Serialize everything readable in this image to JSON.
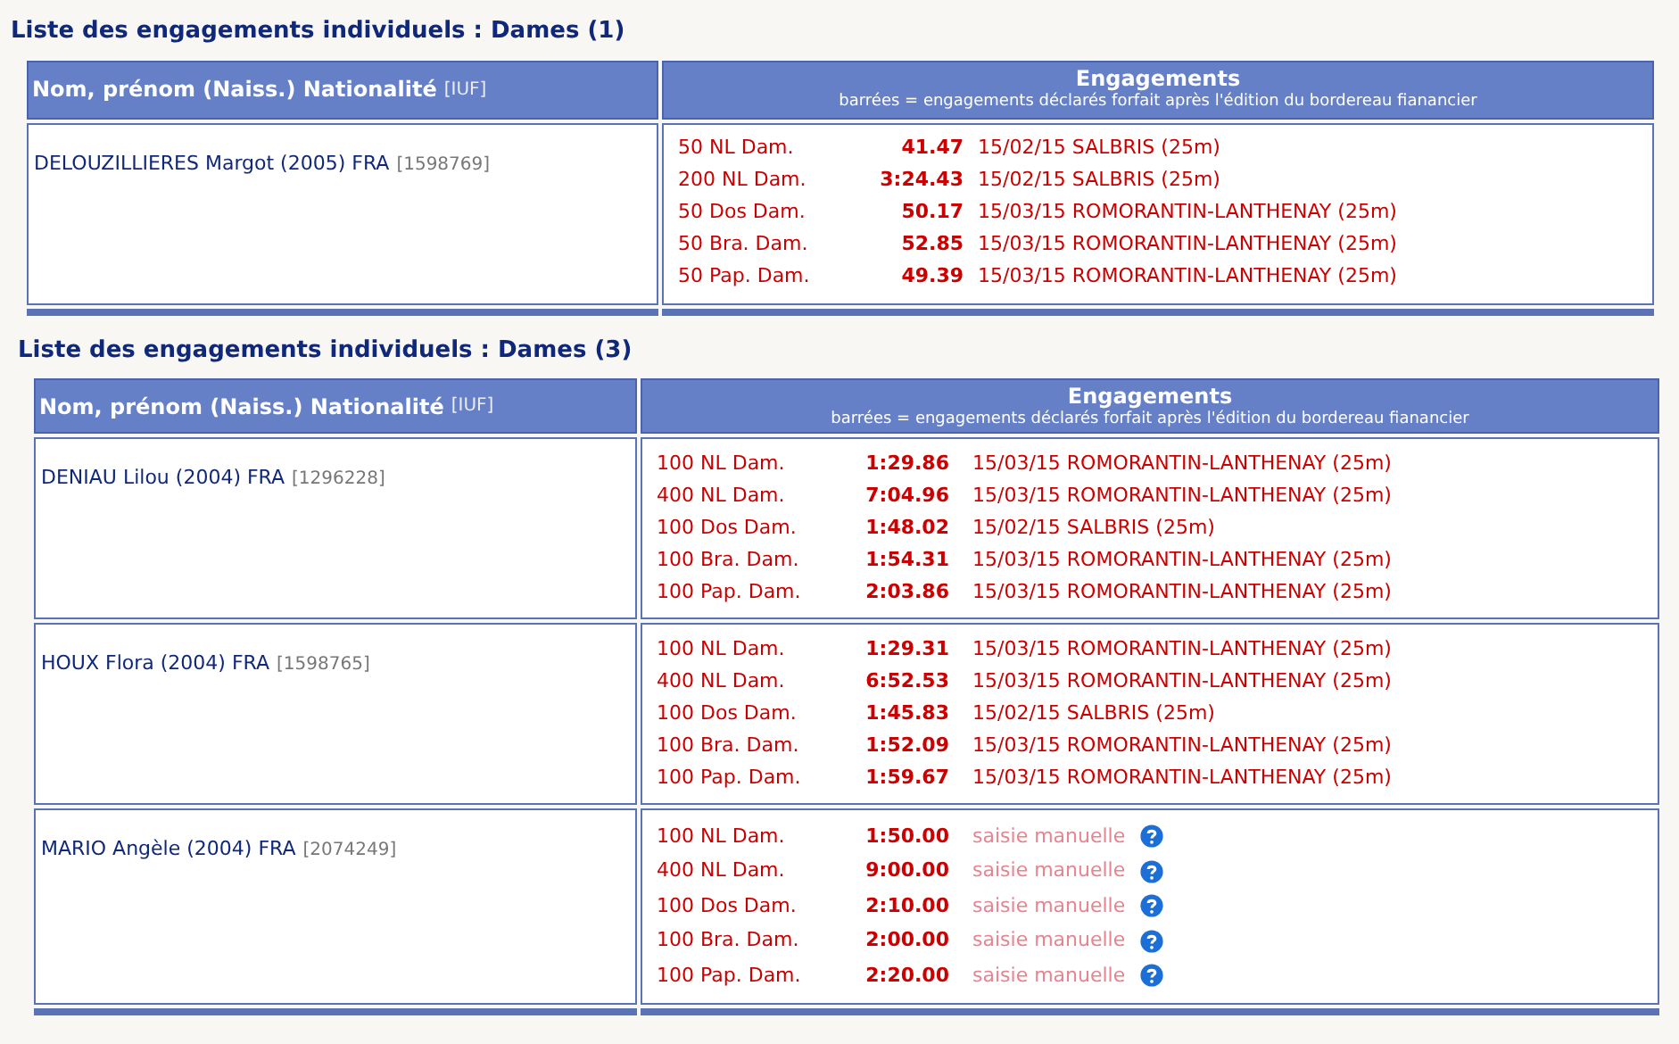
{
  "sections": [
    {
      "title": "Liste des engagements individuels : Dames (1)",
      "columns": {
        "name": "Nom, prénom (Naiss.) Nationalité",
        "iuf": "[IUF]",
        "entries": "Engagements",
        "note": "barrées = engagements déclarés forfait après l'édition du bordereau fianancier"
      },
      "rows": [
        {
          "swimmer": "DELOUZILLIERES Margot (2005) FRA",
          "iuf": "[1598769]",
          "entries": [
            {
              "kind": "meet",
              "event": "50 NL Dam.",
              "time": "41.47",
              "meet": "15/02/15 SALBRIS (25m)"
            },
            {
              "kind": "meet",
              "event": "200 NL Dam.",
              "time": "3:24.43",
              "meet": "15/02/15 SALBRIS (25m)"
            },
            {
              "kind": "meet",
              "event": "50 Dos Dam.",
              "time": "50.17",
              "meet": "15/03/15 ROMORANTIN-LANTHENAY (25m)"
            },
            {
              "kind": "meet",
              "event": "50 Bra. Dam.",
              "time": "52.85",
              "meet": "15/03/15 ROMORANTIN-LANTHENAY (25m)"
            },
            {
              "kind": "meet",
              "event": "50 Pap. Dam.",
              "time": "49.39",
              "meet": "15/03/15 ROMORANTIN-LANTHENAY (25m)"
            }
          ]
        }
      ]
    },
    {
      "title": "Liste des engagements individuels : Dames (3)",
      "columns": {
        "name": "Nom, prénom (Naiss.) Nationalité",
        "iuf": "[IUF]",
        "entries": "Engagements",
        "note": "barrées = engagements déclarés forfait après l'édition du bordereau fianancier"
      },
      "rows": [
        {
          "swimmer": "DENIAU Lilou (2004) FRA",
          "iuf": "[1296228]",
          "entries": [
            {
              "kind": "meet",
              "event": "100 NL Dam.",
              "time": "1:29.86",
              "meet": "15/03/15 ROMORANTIN-LANTHENAY (25m)"
            },
            {
              "kind": "meet",
              "event": "400 NL Dam.",
              "time": "7:04.96",
              "meet": "15/03/15 ROMORANTIN-LANTHENAY (25m)"
            },
            {
              "kind": "meet",
              "event": "100 Dos Dam.",
              "time": "1:48.02",
              "meet": "15/02/15 SALBRIS (25m)"
            },
            {
              "kind": "meet",
              "event": "100 Bra. Dam.",
              "time": "1:54.31",
              "meet": "15/03/15 ROMORANTIN-LANTHENAY (25m)"
            },
            {
              "kind": "meet",
              "event": "100 Pap. Dam.",
              "time": "2:03.86",
              "meet": "15/03/15 ROMORANTIN-LANTHENAY (25m)"
            }
          ]
        },
        {
          "swimmer": "HOUX Flora (2004) FRA",
          "iuf": "[1598765]",
          "entries": [
            {
              "kind": "meet",
              "event": "100 NL Dam.",
              "time": "1:29.31",
              "meet": "15/03/15 ROMORANTIN-LANTHENAY (25m)"
            },
            {
              "kind": "meet",
              "event": "400 NL Dam.",
              "time": "6:52.53",
              "meet": "15/03/15 ROMORANTIN-LANTHENAY (25m)"
            },
            {
              "kind": "meet",
              "event": "100 Dos Dam.",
              "time": "1:45.83",
              "meet": "15/02/15 SALBRIS (25m)"
            },
            {
              "kind": "meet",
              "event": "100 Bra. Dam.",
              "time": "1:52.09",
              "meet": "15/03/15 ROMORANTIN-LANTHENAY (25m)"
            },
            {
              "kind": "meet",
              "event": "100 Pap. Dam.",
              "time": "1:59.67",
              "meet": "15/03/15 ROMORANTIN-LANTHENAY (25m)"
            }
          ]
        },
        {
          "swimmer": "MARIO Angèle (2004) FRA",
          "iuf": "[2074249]",
          "entries": [
            {
              "kind": "manual",
              "event": "100 NL Dam.",
              "time": "1:50.00",
              "meet": "saisie manuelle"
            },
            {
              "kind": "manual",
              "event": "400 NL Dam.",
              "time": "9:00.00",
              "meet": "saisie manuelle"
            },
            {
              "kind": "manual",
              "event": "100 Dos Dam.",
              "time": "2:10.00",
              "meet": "saisie manuelle"
            },
            {
              "kind": "manual",
              "event": "100 Bra. Dam.",
              "time": "2:00.00",
              "meet": "saisie manuelle"
            },
            {
              "kind": "manual",
              "event": "100 Pap. Dam.",
              "time": "2:20.00",
              "meet": "saisie manuelle"
            }
          ]
        }
      ]
    }
  ]
}
